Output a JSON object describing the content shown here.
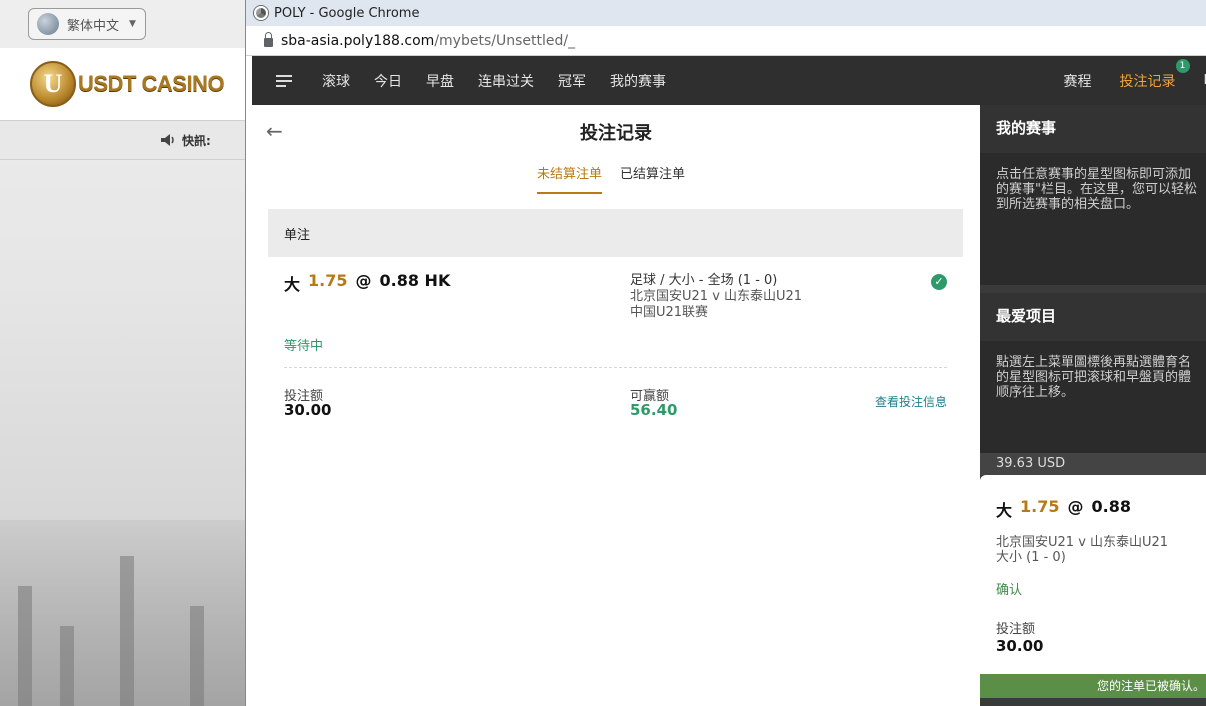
{
  "casino": {
    "language": "繁体中文",
    "logo_letter": "U",
    "logo_text": "USDT CASINO",
    "news_label": "快訊:"
  },
  "chrome": {
    "title": "POLY - Google Chrome",
    "url_domain": "sba-asia.poly188.com",
    "url_path": "/mybets/Unsettled/_"
  },
  "nav": {
    "items": [
      "滚球",
      "今日",
      "早盘",
      "连串过关",
      "冠军",
      "我的赛事"
    ],
    "right_items": [
      "赛程",
      "投注记录"
    ],
    "badge": "1",
    "cut_label": "F"
  },
  "page": {
    "title": "投注记录",
    "tabs": [
      "未结算注单",
      "已结算注单"
    ],
    "section_label": "单注"
  },
  "bet": {
    "selection": "大",
    "handicap": "1.75",
    "at": "@",
    "odds": "0.88 HK",
    "market": "足球 / 大小 - 全场 (1 - 0)",
    "match": "北京国安U21 v 山东泰山U21",
    "league": "中国U21联赛",
    "status": "等待中",
    "stake_label": "投注额",
    "stake": "30.00",
    "win_label": "可赢额",
    "win": "56.40",
    "detail_link": "查看投注信息"
  },
  "sidebar": {
    "my_events": {
      "title": "我的赛事",
      "lines": [
        "点击任意赛事的星型图标即可添加",
        "的赛事\"栏目。在这里，您可以轻松",
        "到所选赛事的相关盘口。"
      ]
    },
    "favorites": {
      "title": "最爱项目",
      "lines": [
        "點選左上菜單圖標後再點選體育名",
        "的星型图标可把滚球和早盤頁的體",
        "顺序往上移。"
      ]
    }
  },
  "betslip": {
    "balance": "39.63 USD",
    "selection": "大",
    "handicap": "1.75",
    "at": "@",
    "odds": "0.88",
    "match": "北京国安U21 v 山东泰山U21",
    "market": "大小 (1 - 0)",
    "status": "确认",
    "stake_label": "投注额",
    "stake": "30.00",
    "confirm_message": "您的注单已被确认。"
  },
  "colors": {
    "accent_gold": "#b77a14",
    "nav_bg": "#2f2f2f",
    "active_nav": "#f0a23b",
    "success_green": "#2e9a6a",
    "confirm_bar": "#5b8f47"
  }
}
